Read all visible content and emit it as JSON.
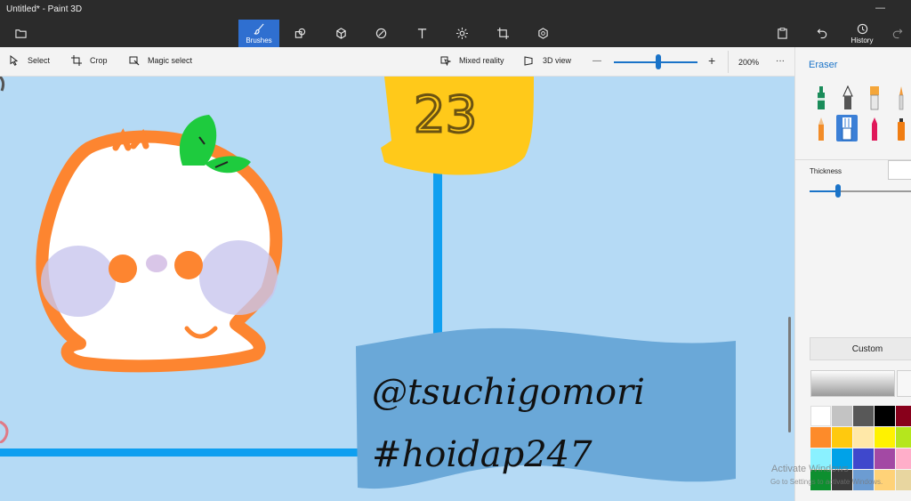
{
  "window": {
    "title": "Untitled* - Paint 3D"
  },
  "main_toolbar": {
    "brushes_label": "Brushes",
    "history_label": "History"
  },
  "sub_toolbar": {
    "select": "Select",
    "crop": "Crop",
    "magic_select": "Magic select",
    "mixed_reality": "Mixed reality",
    "view_3d": "3D view",
    "zoom_minus": "—",
    "zoom_plus": "+",
    "zoom_level": "200%",
    "more": "···",
    "zoom_value_fraction": 0.53
  },
  "canvas": {
    "flag_text_line1": "@tsuchigomori",
    "flag_text_line2": "#hoidap247",
    "sign_text": "23",
    "background_color": "#b5daf5"
  },
  "panel": {
    "title": "Eraser",
    "thickness_label": "Thickness",
    "custom_label": "Custom",
    "thickness_value_fraction": 0.27,
    "accent_color": "#1a73c8",
    "palette": [
      "#ffffff",
      "#c3c3c3",
      "#585858",
      "#000000",
      "#88001b",
      "#fd8b2a",
      "#ffc90e",
      "#ffe8a8",
      "#fff200",
      "#b5e61d",
      "#8af1ff",
      "#00a2e8",
      "#3f48cc",
      "#a349a4",
      "#ffaec9",
      "#0d8f2f",
      "#3a3a3a",
      "#6c9cd2",
      "#ffd278",
      "#e8d6a0"
    ]
  },
  "watermark": {
    "line1": "Activate Windows",
    "line2": "Go to Settings to activate Windows."
  }
}
